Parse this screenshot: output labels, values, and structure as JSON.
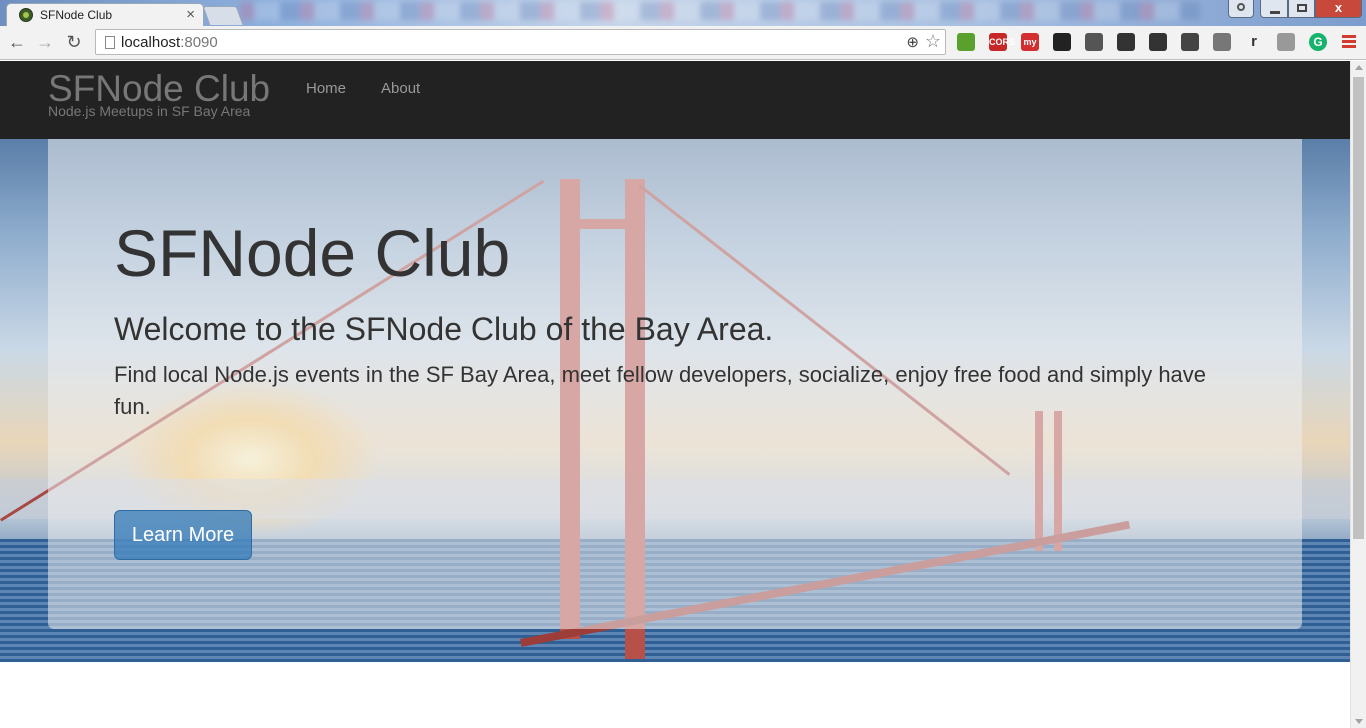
{
  "browser": {
    "tab_title": "SFNode Club",
    "tab_close": "×",
    "window_close": "x",
    "url_host": "localhost",
    "url_port": ":8090",
    "nav": {
      "back": "←",
      "forward": "→",
      "reload": "↻"
    },
    "extensions": [
      {
        "name": "tree-extension-icon",
        "label": "",
        "color": "#5aa02c"
      },
      {
        "name": "cors-extension-icon",
        "label": "CORS",
        "color": "#c62828"
      },
      {
        "name": "my-extension-icon",
        "label": "my",
        "color": "#d32f2f"
      },
      {
        "name": "owl-extension-icon",
        "label": "",
        "color": "#222222"
      },
      {
        "name": "cast-extension-icon",
        "label": "",
        "color": "#555555"
      },
      {
        "name": "screen-extension-icon",
        "label": "",
        "color": "#333333"
      },
      {
        "name": "compass-extension-icon",
        "label": "",
        "color": "#333333"
      },
      {
        "name": "evernote-extension-icon",
        "label": "",
        "color": "#444444"
      },
      {
        "name": "copy-extension-icon",
        "label": "",
        "color": "#777777"
      },
      {
        "name": "r-extension-icon",
        "label": "r",
        "color": "#333333"
      },
      {
        "name": "notes-extension-icon",
        "label": "",
        "color": "#999999"
      },
      {
        "name": "grammarly-extension-icon",
        "label": "G",
        "color": "#15b36b"
      }
    ]
  },
  "navbar": {
    "brand_title": "SFNode Club",
    "brand_subtitle": "Node.js Meetups in SF Bay Area",
    "links": [
      "Home",
      "About"
    ]
  },
  "hero": {
    "title": "SFNode Club",
    "headline": "Welcome to the SFNode Club of the Bay Area.",
    "description": "Find local Node.js events in the SF Bay Area, meet fellow developers, socialize, enjoy free food and simply have fun.",
    "button_label": "Learn More"
  },
  "colors": {
    "navbar_bg": "#222222",
    "nav_text": "#999999",
    "button_primary": "#337ab7"
  }
}
